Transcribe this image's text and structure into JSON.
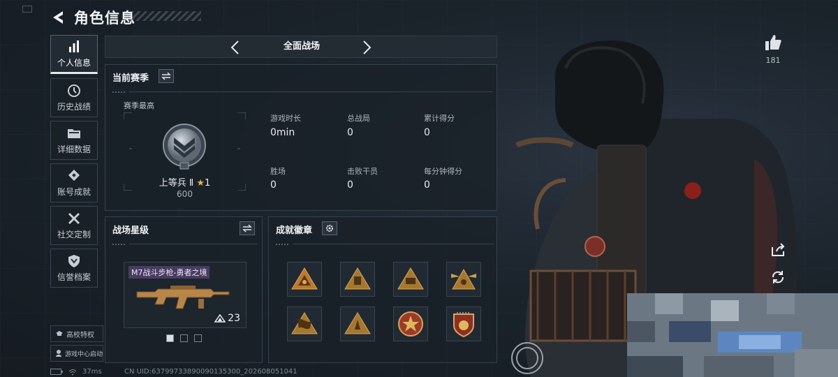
{
  "header": {
    "title": "角色信息"
  },
  "sidebar": {
    "items": [
      {
        "label": "个人信息",
        "icon": "bar-chart-icon",
        "active": true
      },
      {
        "label": "历史战绩",
        "icon": "clock-icon"
      },
      {
        "label": "详细数据",
        "icon": "folder-icon"
      },
      {
        "label": "账号成就",
        "icon": "diamond-badge-icon"
      },
      {
        "label": "社交定制",
        "icon": "tools-icon"
      },
      {
        "label": "信誉档案",
        "icon": "shield-icon"
      }
    ],
    "campus_privilege": "高校特权",
    "game_center": "游戏中心启动"
  },
  "status_bar": {
    "ping": "37ms",
    "uid": "CN UID:6379973389009013530​0_202608051041"
  },
  "mode": {
    "title": "全面战场"
  },
  "season": {
    "title": "当前赛季",
    "best_label": "赛季最高",
    "rank_name": "上等兵 Ⅱ",
    "rank_stars": "1",
    "rank_score": "600",
    "stats": [
      {
        "label": "游戏时长",
        "value": "0min"
      },
      {
        "label": "总战局",
        "value": "0"
      },
      {
        "label": "累计得分",
        "value": "0"
      },
      {
        "label": "胜场",
        "value": "0"
      },
      {
        "label": "击败干员",
        "value": "0"
      },
      {
        "label": "每分钟得分",
        "value": "0"
      }
    ]
  },
  "stars_panel": {
    "title": "战场星级",
    "weapon_name": "M7战斗步枪-勇者之境",
    "weapon_level": "23"
  },
  "achievements": {
    "title": "成就徽章"
  },
  "social": {
    "likes": "181"
  },
  "colors": {
    "accent": "#e6e9ec",
    "panel": "#1a2128",
    "gold": "#c9a04a"
  }
}
